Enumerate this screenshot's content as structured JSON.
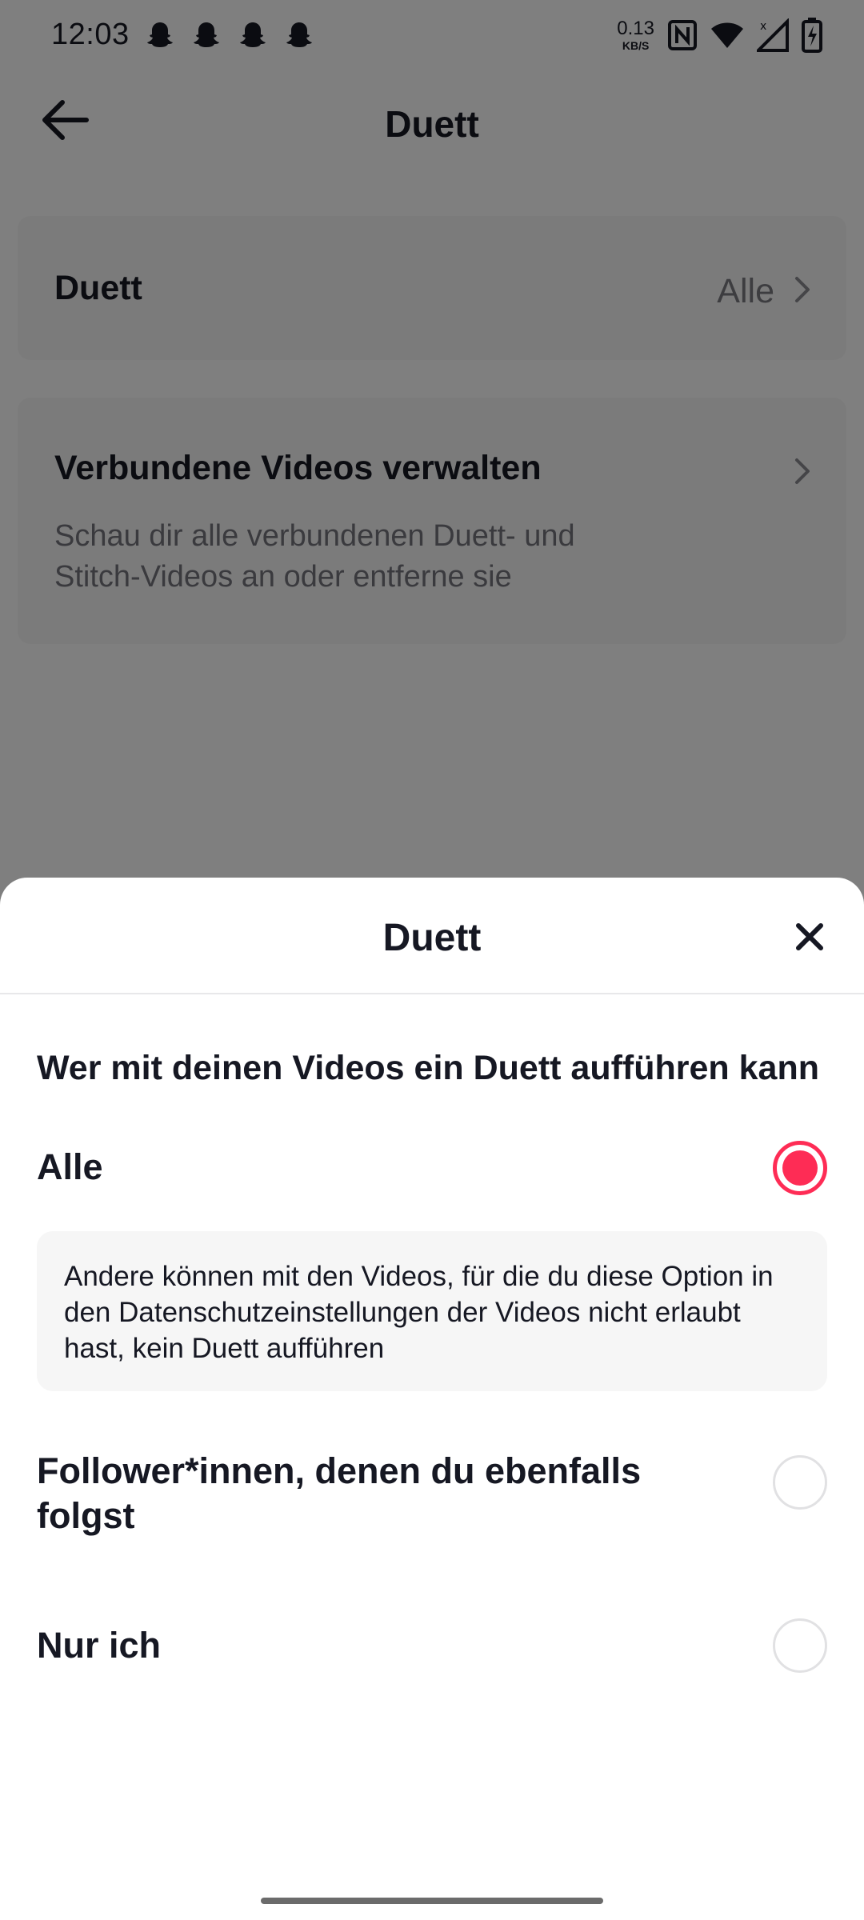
{
  "status_bar": {
    "time": "12:03",
    "net_speed_value": "0.13",
    "net_speed_unit": "KB/S",
    "notification_icons": [
      "snapchat-icon",
      "snapchat-icon",
      "snapchat-icon",
      "snapchat-icon"
    ],
    "system_icons": [
      "nfc-icon",
      "wifi-icon",
      "signal-icon",
      "battery-charging-icon"
    ]
  },
  "header": {
    "title": "Duett",
    "back_icon": "arrow-left-icon"
  },
  "settings": {
    "duet_row": {
      "label": "Duett",
      "value": "Alle"
    },
    "manage_row": {
      "label": "Verbundene Videos verwalten",
      "description": "Schau dir alle verbundenen Duett- und Stitch-Videos an oder entferne sie"
    }
  },
  "sheet": {
    "title": "Duett",
    "close_icon": "close-icon",
    "subtitle": "Wer mit deinen Videos ein Duett aufführen kann",
    "options": [
      {
        "label": "Alle",
        "selected": true
      },
      {
        "label": "Follower*innen, denen du ebenfalls folgst",
        "selected": false
      },
      {
        "label": "Nur ich",
        "selected": false
      }
    ],
    "info": "Andere können mit den Videos, für die du diese Option in den Datenschutzeinstellungen der Videos nicht erlaubt hast, kein Duett aufführen"
  },
  "colors": {
    "accent": "#fe2c55",
    "text_primary": "#161823",
    "text_secondary": "#75757d",
    "card_bg": "#f7f7f7"
  }
}
